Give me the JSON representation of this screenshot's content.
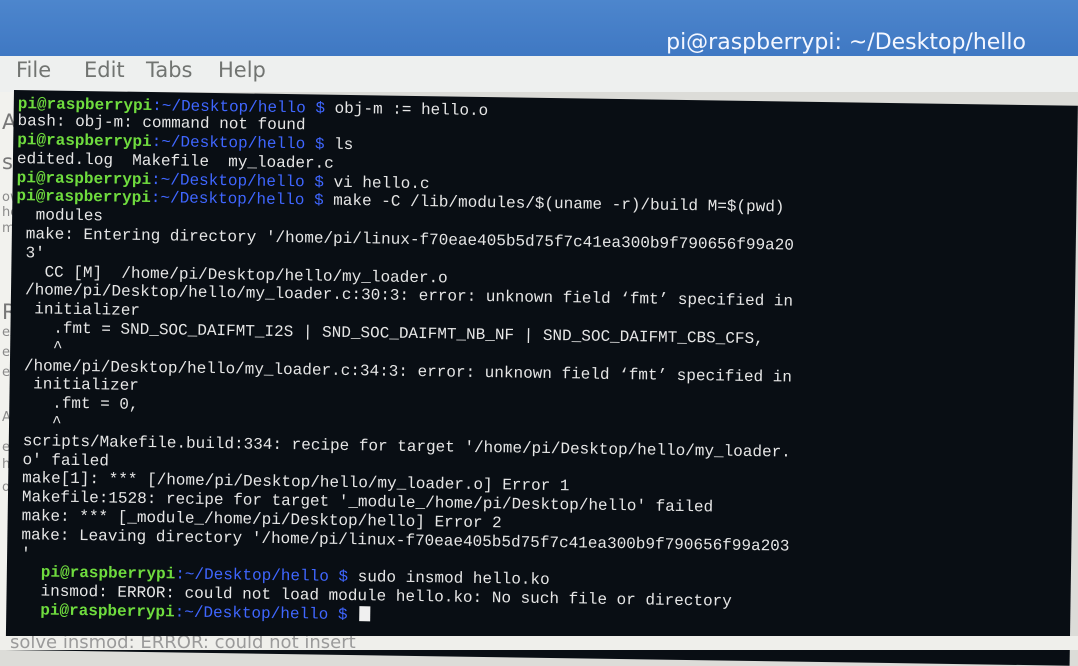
{
  "window": {
    "title": "pi@raspberrypi: ~/Desktop/hello"
  },
  "menu": {
    "items": [
      "File",
      "Edit",
      "Tabs",
      "Help"
    ]
  },
  "terminal": {
    "prompt_user": "pi@raspberrypi",
    "prompt_path": ":~/Desktop/hello $",
    "lines": [
      {
        "prompt": true,
        "cmd": "obj-m := hello.o"
      },
      {
        "text": "bash: obj-m: command not found"
      },
      {
        "prompt": true,
        "cmd": "ls"
      },
      {
        "text": "edited.log  Makefile  my_loader.c"
      },
      {
        "prompt": true,
        "cmd": "vi hello.c"
      },
      {
        "prompt": true,
        "cmd": "make -C /lib/modules/$(uname -r)/build M=$(pwd)"
      },
      {
        "text": " modules"
      },
      {
        "text": "make: Entering directory '/home/pi/linux-f70eae405b5d75f7c41ea300b9f790656f99a20"
      },
      {
        "text": "3'"
      },
      {
        "text": "  CC [M]  /home/pi/Desktop/hello/my_loader.o"
      },
      {
        "text": "/home/pi/Desktop/hello/my_loader.c:30:3: error: unknown field ‘fmt’ specified in"
      },
      {
        "text": " initializer"
      },
      {
        "text": "   .fmt = SND_SOC_DAIFMT_I2S | SND_SOC_DAIFMT_NB_NF | SND_SOC_DAIFMT_CBS_CFS,"
      },
      {
        "text": "   ^"
      },
      {
        "text": "/home/pi/Desktop/hello/my_loader.c:34:3: error: unknown field ‘fmt’ specified in"
      },
      {
        "text": " initializer"
      },
      {
        "text": "   .fmt = 0,"
      },
      {
        "text": "   ^"
      },
      {
        "text": "scripts/Makefile.build:334: recipe for target '/home/pi/Desktop/hello/my_loader."
      },
      {
        "text": "o' failed"
      },
      {
        "text": "make[1]: *** [/home/pi/Desktop/hello/my_loader.o] Error 1"
      },
      {
        "text": "Makefile:1528: recipe for target '_module_/home/pi/Desktop/hello' failed"
      },
      {
        "text": "make: *** [_module_/home/pi/Desktop/hello] Error 2"
      },
      {
        "text": "make: Leaving directory '/home/pi/linux-f70eae405b5d75f7c41ea300b9f790656f99a203"
      },
      {
        "text": "'"
      },
      {
        "prompt": true,
        "cmd": "sudo insmod hello.ko"
      },
      {
        "text": "insmod: ERROR: could not load module hello.ko: No such file or directory"
      },
      {
        "prompt": true,
        "cmd": "",
        "cursor": true
      }
    ]
  },
  "background": {
    "left_fragments": [
      "A",
      "sn",
      "ow",
      "he",
      "mc",
      "RC",
      "excl",
      "e m",
      "e to",
      "AL:",
      "exc",
      "hello",
      "oot/"
    ],
    "bottom_text": "solve  insmod: ERROR: could not insert"
  },
  "colors": {
    "prompt_user": "#6fdc3e",
    "prompt_path": "#3f66ff",
    "terminal_bg": "#090e14",
    "titlebar": "#4583c9"
  }
}
